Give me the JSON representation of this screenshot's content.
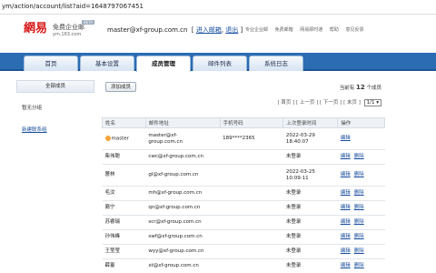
{
  "url": "ym/action/account/list?aid=1648797067451",
  "header": {
    "logo_text": "網易",
    "product": "免费企业邮",
    "badge": "BETA",
    "subdomain": "ym.163.com",
    "account": "master@xf-group.com.cn",
    "enter_mail": "进入邮箱",
    "logout": "退出",
    "links": [
      "专业企业邮",
      "免费邮箱",
      "网易即时通",
      "帮助",
      "意见反馈"
    ]
  },
  "nav": {
    "tabs": [
      {
        "label": "首页",
        "active": false
      },
      {
        "label": "基本设置",
        "active": false
      },
      {
        "label": "成员管理",
        "active": true
      },
      {
        "label": "邮件列表",
        "active": false
      },
      {
        "label": "系统日志",
        "active": false
      }
    ]
  },
  "sidebar": {
    "header": "全部成员",
    "items": [
      "暂无分组"
    ],
    "new_link": "新建联系组"
  },
  "toolbar": {
    "add_member": "添加成员",
    "total_prefix": "当前有",
    "total_count": "12",
    "total_suffix": "个成员"
  },
  "pager": {
    "first": "[ 首页 ]",
    "prev": "[ 上一页 ]",
    "next": "[ 下一页 ]",
    "last": "[ 末页 ]",
    "page": "1/1"
  },
  "table": {
    "columns": [
      "姓名",
      "邮件地址",
      "手机号码",
      "上次登录时间",
      "操作"
    ],
    "rows": [
      {
        "name": "master",
        "email": "master@xf-\ngroup.com.cn",
        "phone": "189****2365",
        "login": "2022-03-29\n18:40:07",
        "edit": "编辑",
        "del": ""
      },
      {
        "name": "柴伟聪",
        "email": "cwc@xf-group.com.cn",
        "phone": "",
        "login": "未登录",
        "edit": "编辑",
        "del": "删除"
      },
      {
        "name": "蔷林",
        "email": "gl@xf-group.com.cn",
        "phone": "",
        "login": "2022-03-25\n10:09:11",
        "edit": "编辑",
        "del": "删除"
      },
      {
        "name": "毛汶",
        "email": "mh@xf-group.com.cn",
        "phone": "",
        "login": "未登录",
        "edit": "编辑",
        "del": "删除"
      },
      {
        "name": "裔宁",
        "email": "qn@xf-group.com.cn",
        "phone": "",
        "login": "未登录",
        "edit": "编辑",
        "del": "删除"
      },
      {
        "name": "苏睿瑞",
        "email": "scr@xf-group.com.cn",
        "phone": "",
        "login": "未登录",
        "edit": "编辑",
        "del": "删除"
      },
      {
        "name": "孙伟峰",
        "email": "swf@xf-group.com.cn",
        "phone": "",
        "login": "未登录",
        "edit": "编辑",
        "del": "删除"
      },
      {
        "name": "王莹莹",
        "email": "wyy@xf-group.com.cn",
        "phone": "",
        "login": "未登录",
        "edit": "编辑",
        "del": "删除"
      },
      {
        "name": "薛薹",
        "email": "xt@xf-group.com.cn",
        "phone": "",
        "login": "未登录",
        "edit": "编辑",
        "del": "删除"
      }
    ]
  },
  "colors": {
    "nav_blue": "#2b6cb3",
    "link": "#1a4fa0",
    "logo_red": "#d71a1b"
  }
}
